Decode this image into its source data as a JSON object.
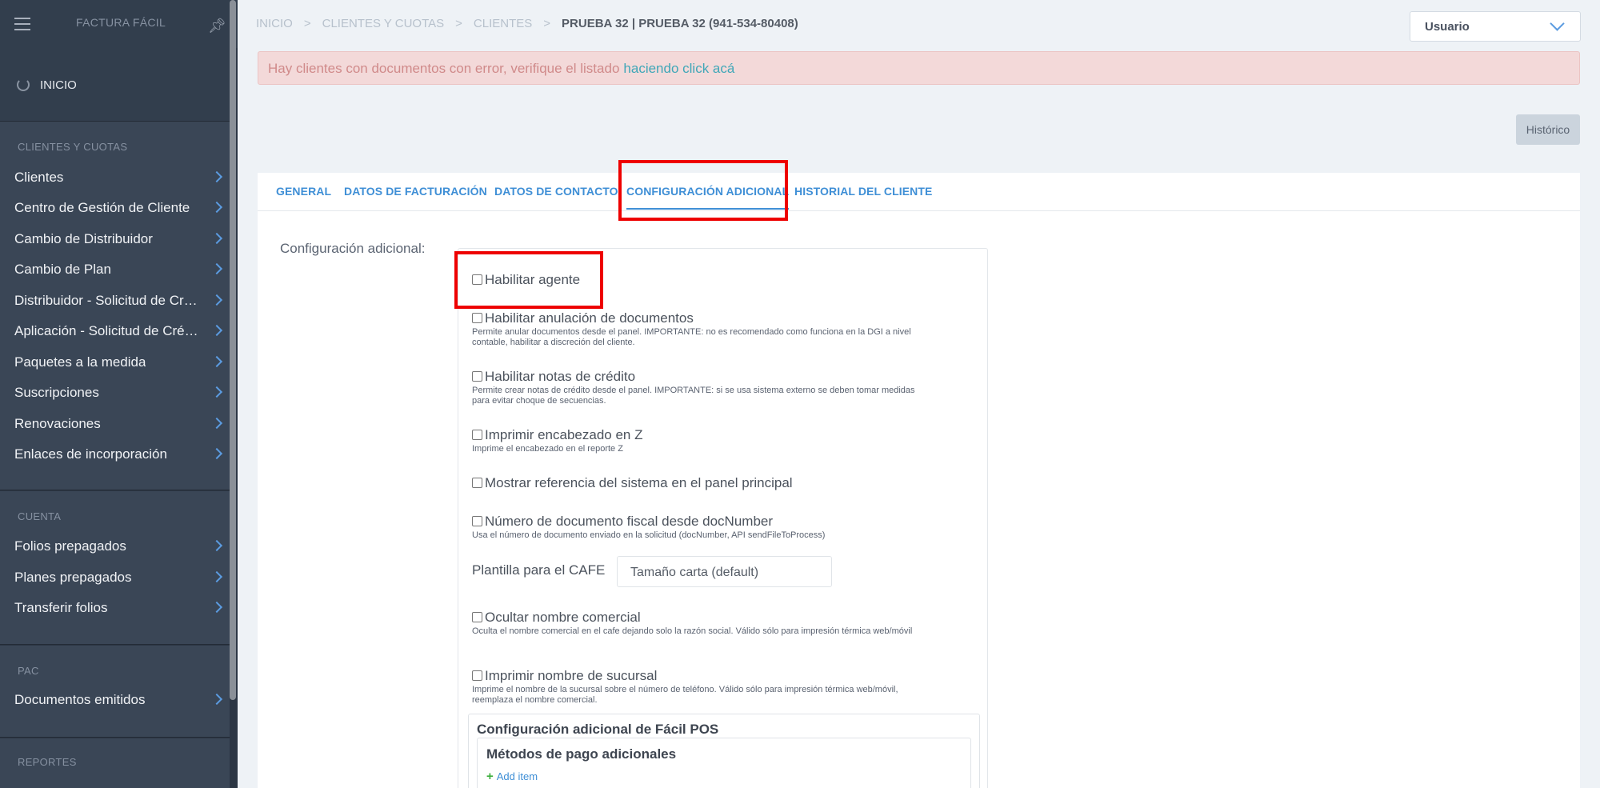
{
  "sidebar": {
    "brand": "FACTURA FÁCIL",
    "home": "INICIO",
    "sections": [
      {
        "title": "CLIENTES Y CUOTAS",
        "items": [
          "Clientes",
          "Centro de Gestión de Cliente",
          "Cambio de Distribuidor",
          "Cambio de Plan",
          "Distribuidor - Solicitud de Crédito",
          "Aplicación - Solicitud de Crédito",
          "Paquetes a la medida",
          "Suscripciones",
          "Renovaciones",
          "Enlaces de incorporación"
        ]
      },
      {
        "title": "CUENTA",
        "items": [
          "Folios prepagados",
          "Planes prepagados",
          "Transferir folios"
        ]
      },
      {
        "title": "PAC",
        "items": [
          "Documentos emitidos"
        ]
      },
      {
        "title": "REPORTES",
        "items": []
      }
    ]
  },
  "breadcrumb": [
    "INICIO",
    "CLIENTES Y CUOTAS",
    "CLIENTES",
    "PRUEBA 32 | PRUEBA 32 (941-534-80408)"
  ],
  "user_select": "Usuario",
  "alert": {
    "message": "Hay clientes con documentos con error, verifique el listado",
    "link": "haciendo click acá"
  },
  "historico_button": "Histórico",
  "tabs": [
    "GENERAL",
    "DATOS DE FACTURACIÓN",
    "DATOS DE CONTACTO",
    "CONFIGURACIÓN ADICIONAL",
    "HISTORIAL DEL CLIENTE"
  ],
  "config": {
    "label": "Configuración adicional:",
    "options": [
      {
        "title": "Habilitar agente",
        "desc": ""
      },
      {
        "title": "Habilitar anulación de documentos",
        "desc": "Permite anular documentos desde el panel. IMPORTANTE: no es recomendado como funciona en la DGI a nivel contable, habilitar a discreción del cliente."
      },
      {
        "title": "Habilitar notas de crédito",
        "desc": "Permite crear notas de crédito desde el panel. IMPORTANTE: si se usa sistema externo se deben tomar medidas para evitar choque de secuencias."
      },
      {
        "title": "Imprimir encabezado en Z",
        "desc": "Imprime el encabezado en el reporte Z"
      },
      {
        "title": "Mostrar referencia del sistema en el panel principal",
        "desc": ""
      },
      {
        "title": "Número de documento fiscal desde docNumber",
        "desc": "Usa el número de documento enviado en la solicitud (docNumber, API sendFileToProcess)"
      },
      {
        "title": "Ocultar nombre comercial",
        "desc": "Oculta el nombre comercial en el cafe dejando solo la razón social. Válido sólo para impresión térmica web/móvil"
      },
      {
        "title": "Imprimir nombre de sucursal",
        "desc": "Imprime el nombre de la sucursal sobre el número de teléfono. Válido sólo para impresión térmica web/móvil, reemplaza el nombre comercial."
      }
    ],
    "cafe_label": "Plantilla para el CAFE",
    "cafe_value": "Tamaño carta (default)",
    "pos_title": "Configuración adicional de Fácil POS",
    "payment_title": "Métodos de pago adicionales",
    "add_item": "Add item"
  },
  "colors": {
    "sidebar_bg": "#2c3644",
    "accent": "#3f8fd6",
    "highlight": "#ee0000",
    "alert_bg": "#f3d9d9"
  }
}
